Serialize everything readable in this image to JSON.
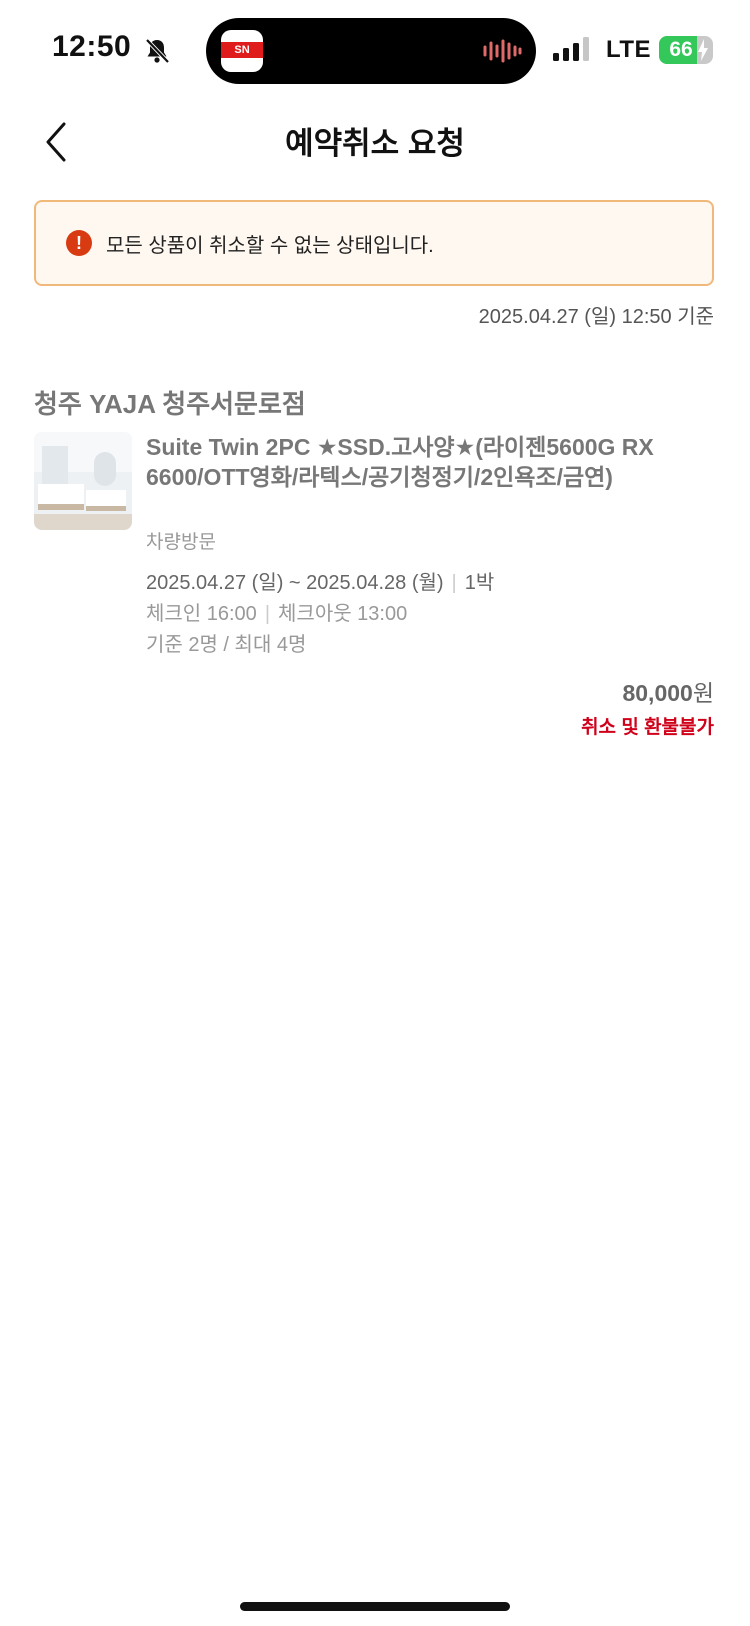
{
  "status_bar": {
    "time": "12:50",
    "network": "LTE",
    "battery": "66",
    "island_app_text": "SN"
  },
  "header": {
    "title": "예약취소 요청",
    "back_icon": "chevron-left-icon"
  },
  "notice": {
    "icon": "info-icon",
    "icon_glyph": "!",
    "text": "모든 상품이 취소할 수 없는 상태입니다.",
    "border_color": "#f0b97a",
    "background": "#fff8f0",
    "icon_color": "#d83b12"
  },
  "as_of": "2025.04.27 (일) 12:50 기준",
  "reservation": {
    "hotel_name": "청주 YAJA 청주서문로점",
    "room_name": "Suite Twin 2PC ★SSD.고사양★(라이젠5600G RX 6600/OTT영화/라텍스/공기청정기/2인욕조/금연)",
    "visit_type": "차량방문",
    "dates": "2025.04.27 (일) ~ 2025.04.28 (월)",
    "nights": "1박",
    "checkin": "체크인 16:00",
    "checkout": "체크아웃 13:00",
    "guests": "기준 2명 / 최대 4명",
    "price": "80,000",
    "currency": "원",
    "refund_status": "취소 및 환불불가",
    "refund_color": "#d0021b"
  }
}
